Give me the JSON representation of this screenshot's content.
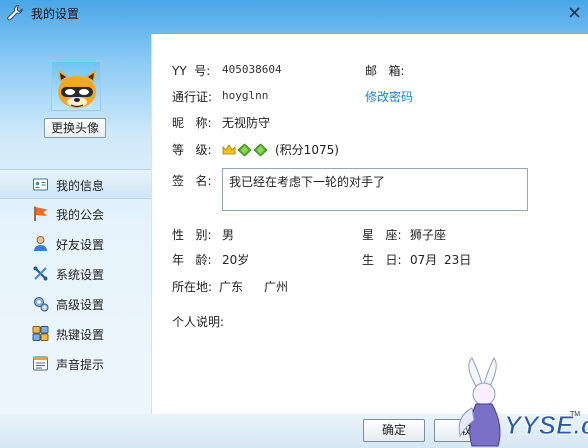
{
  "window": {
    "title": "我的设置",
    "close_icon": "close-icon"
  },
  "sidebar": {
    "change_avatar_label": "更换头像",
    "items": [
      {
        "label": "我的信息",
        "icon": "id-card-icon",
        "active": true
      },
      {
        "label": "我的公会",
        "icon": "flag-icon",
        "active": false
      },
      {
        "label": "好友设置",
        "icon": "person-icon",
        "active": false
      },
      {
        "label": "系统设置",
        "icon": "wrench-icon",
        "active": false
      },
      {
        "label": "高级设置",
        "icon": "advanced-gear-icon",
        "active": false
      },
      {
        "label": "热键设置",
        "icon": "hotkey-icon",
        "active": false
      },
      {
        "label": "声音提示",
        "icon": "sound-icon",
        "active": false
      }
    ]
  },
  "profile": {
    "yy_label": "YY  号:",
    "yy_value": "405038604",
    "email_label": "邮   箱:",
    "email_value": "",
    "passport_label": "通行证:",
    "passport_value": "hoyglnn",
    "change_password": "修改密码",
    "nickname_label": "昵   称:",
    "nickname_value": "无视防守",
    "level_label": "等   级:",
    "level_points": "(积分1075)",
    "level_icons": [
      "crown-icon",
      "diamond-icon",
      "diamond-icon"
    ],
    "signature_label": "签   名:",
    "signature_value": "我已经在考虑下一轮的对手了",
    "gender_label": "性   别:",
    "gender_value": "男",
    "constellation_label": "星   座:",
    "constellation_value": "狮子座",
    "age_label": "年   龄:",
    "age_value": "20岁",
    "birthday_label": "生   日:",
    "birthday_month": "07月",
    "birthday_day": "23日",
    "location_label": "所在地:",
    "location_province": "广东",
    "location_city": "广州",
    "bio_label": "个人说明:"
  },
  "buttons": {
    "ok": "确定",
    "cancel": "取"
  },
  "watermark": {
    "text": "YYSE.cn",
    "mark": "TM"
  },
  "colors": {
    "accent": "#1a7fd0",
    "title_bg": "#4aa6e8",
    "active_nav": "#cfe6f7"
  }
}
